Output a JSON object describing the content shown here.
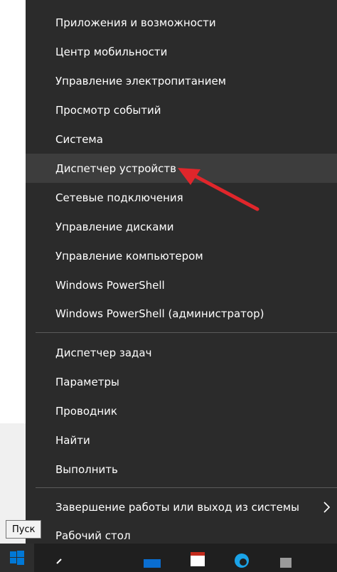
{
  "context_menu": {
    "group1": [
      "Приложения и возможности",
      "Центр мобильности",
      "Управление электропитанием",
      "Просмотр событий",
      "Система",
      "Диспетчер устройств",
      "Сетевые подключения",
      "Управление дисками",
      "Управление компьютером",
      "Windows PowerShell",
      "Windows PowerShell (администратор)"
    ],
    "group2": [
      "Диспетчер задач",
      "Параметры",
      "Проводник",
      "Найти",
      "Выполнить"
    ],
    "group3": [
      "Завершение работы или выход из системы",
      "Рабочий стол"
    ],
    "highlighted_item": "Диспетчер устройств"
  },
  "tooltip": {
    "text": "Пуск"
  },
  "taskbar": {
    "start_icon": "windows-logo-icon",
    "icons": [
      "search-icon",
      "mail-icon",
      "calendar-icon",
      "edge-icon",
      "store-icon"
    ]
  },
  "colors": {
    "menu_background": "#2b2b2b",
    "menu_highlight": "#3d3d3d",
    "menu_text": "#ffffff",
    "annotation_arrow": "#e0262b",
    "windows_blue": "#0078d7"
  }
}
